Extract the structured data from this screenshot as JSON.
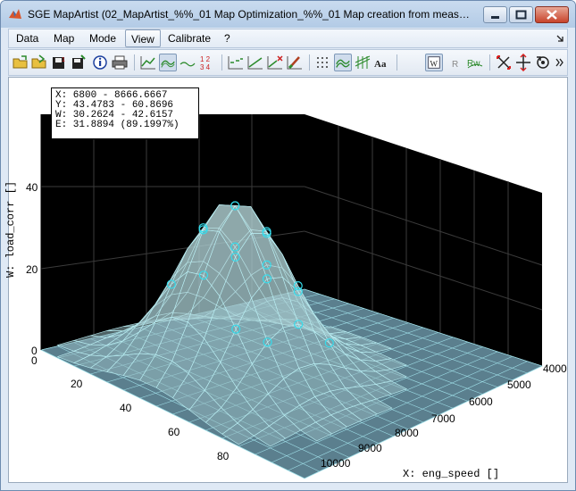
{
  "window": {
    "title": "SGE MapArtist (02_MapArtist_%%_01 Map Optimization_%%_01 Map creation from measurem...",
    "controls": [
      "minimize",
      "maximize",
      "close"
    ]
  },
  "menubar": {
    "items": [
      {
        "label": "Data"
      },
      {
        "label": "Map"
      },
      {
        "label": "Mode"
      },
      {
        "label": "View",
        "active": true
      },
      {
        "label": "Calibrate"
      },
      {
        "label": "?"
      }
    ],
    "overflow_icon": "chevron-right-icon"
  },
  "toolbar": {
    "buttons": [
      {
        "icon": "open-folder-icon"
      },
      {
        "icon": "open-folder-arrow-icon"
      },
      {
        "icon": "save-icon"
      },
      {
        "icon": "save-as-icon"
      },
      {
        "icon": "info-icon"
      },
      {
        "icon": "print-icon"
      },
      {
        "icon": "line-view-icon"
      },
      {
        "icon": "surface-view-icon",
        "pressed": true
      },
      {
        "icon": "flat-line-icon"
      },
      {
        "icon": "table-view-icon",
        "text": "1 2\n3 4"
      },
      {
        "icon": "fit-dashed-icon"
      },
      {
        "icon": "fit-line-icon"
      },
      {
        "icon": "fit-remove-icon"
      },
      {
        "icon": "edit-brush-icon"
      },
      {
        "icon": "points-grid-icon"
      },
      {
        "icon": "mesh-icon",
        "pressed": true
      },
      {
        "icon": "grid-lines-icon"
      },
      {
        "icon": "font-icon",
        "text": "Aa"
      },
      {
        "icon": "w-axis-icon",
        "text": "W",
        "pressed": true
      },
      {
        "icon": "r-axis-icon",
        "text": "R"
      },
      {
        "icon": "rw-axis-icon",
        "text": "Rw"
      },
      {
        "icon": "rotate-axes-icon"
      },
      {
        "icon": "scale-axes-icon"
      },
      {
        "icon": "reset-view-icon"
      }
    ],
    "overflow_icon": "double-chevron-icon"
  },
  "info_box": {
    "x_range": "X: 6800 - 8666.6667",
    "y_range": "Y: 43.4783 - 60.8696",
    "w_range": "W: 30.2624 - 42.6157",
    "error": "E: 31.8894 (89.1997%)"
  },
  "plot": {
    "type": "3d-surface",
    "z_axis": {
      "label": "W: load_corr []",
      "ticks": [
        "40",
        "20",
        "0"
      ],
      "range": [
        0,
        40
      ]
    },
    "y_axis": {
      "ticks": [
        "0",
        "20",
        "40",
        "60",
        "80"
      ]
    },
    "x_axis": {
      "label": "X: eng_speed []",
      "ticks": [
        "4000",
        "5000",
        "6000",
        "7000",
        "8000",
        "9000",
        "10000"
      ]
    },
    "colors": {
      "pane_back": "#000000",
      "floor": "#5b7f8e",
      "mesh": "#9fdfe8",
      "marker": "#35dcec"
    }
  },
  "chart_data": {
    "type": "surface",
    "x": [
      4000,
      5000,
      6000,
      7000,
      8000,
      9000,
      10000
    ],
    "y": [
      0,
      20,
      40,
      60,
      80
    ],
    "xlabel": "X: eng_speed []",
    "ylabel": "",
    "zlabel": "W: load_corr []",
    "zlim": [
      0,
      40
    ],
    "grid": true
  }
}
